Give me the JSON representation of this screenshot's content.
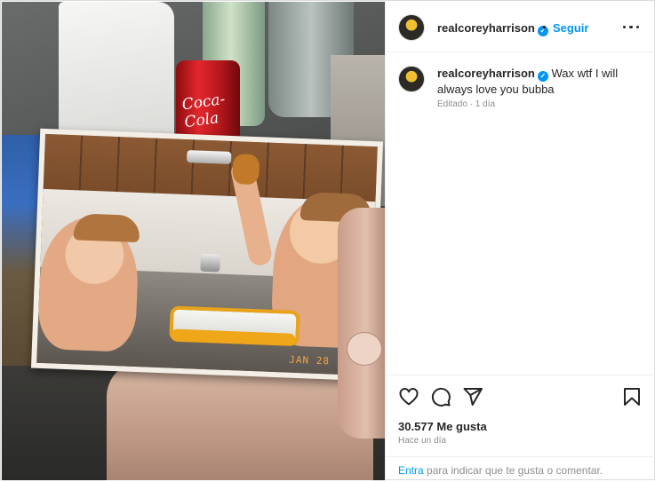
{
  "post": {
    "photo": {
      "can_text": "Coca-Cola",
      "date_stamp": "JAN 28 '88"
    },
    "header": {
      "username": "realcoreyharrison",
      "verified_mark": "✓",
      "separator": "•",
      "follow_label": "Seguir"
    },
    "caption": {
      "username": "realcoreyharrison",
      "text": "Wax wtf I will always love you bubba",
      "meta": "Editado · 1 día"
    },
    "actions": {
      "likes": "30.577 Me gusta",
      "time_ago": "Hace un día"
    },
    "login_prompt": {
      "link": "Entra",
      "rest": " para indicar que te gusta o comentar."
    }
  },
  "icons": {
    "like": "heart-icon",
    "comment": "comment-icon",
    "share": "share-icon",
    "save": "bookmark-icon",
    "more": "more-options-icon"
  },
  "colors": {
    "accent": "#0095f6",
    "text": "#262626",
    "muted": "#8e8e8e",
    "divider": "#efefef"
  }
}
